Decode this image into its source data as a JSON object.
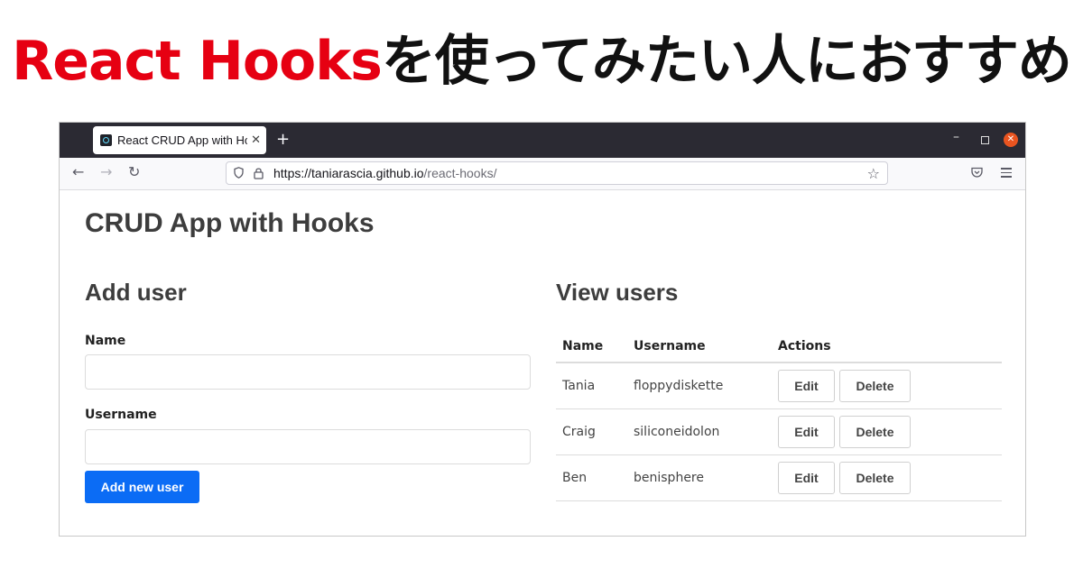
{
  "headline": {
    "highlight": "React Hooks",
    "rest": "を使ってみたい人におすすめ",
    "highlight_color": "#e60012"
  },
  "browser": {
    "tab_title": "React CRUD App with Hooks",
    "tab_icon": "react-favicon-icon",
    "new_tab_label": "+",
    "url_host": "https://taniarascia.github.io",
    "url_path": "/react-hooks/",
    "close_color": "#e95420"
  },
  "page": {
    "title": "CRUD App with Hooks",
    "add_section": {
      "title": "Add user",
      "name_label": "Name",
      "name_value": "",
      "username_label": "Username",
      "username_value": "",
      "submit_label": "Add new user",
      "accent": "#0b6cf5"
    },
    "view_section": {
      "title": "View users",
      "columns": [
        "Name",
        "Username",
        "Actions"
      ],
      "rows": [
        {
          "name": "Tania",
          "username": "floppydiskette"
        },
        {
          "name": "Craig",
          "username": "siliconeidolon"
        },
        {
          "name": "Ben",
          "username": "benisphere"
        }
      ],
      "edit_label": "Edit",
      "delete_label": "Delete"
    }
  }
}
